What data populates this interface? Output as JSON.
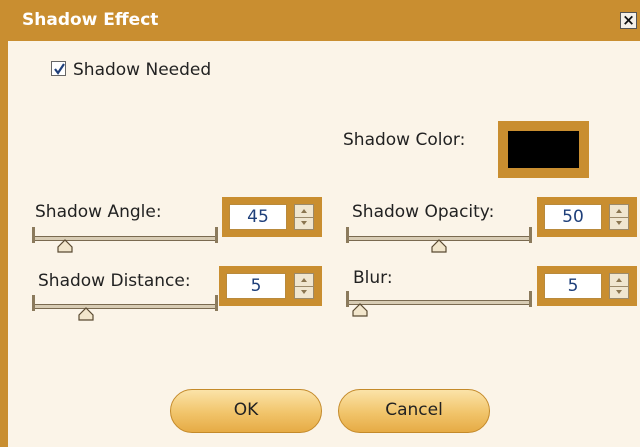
{
  "dialog": {
    "title": "Shadow Effect",
    "close_glyph": "×",
    "shadow_needed": {
      "label": "Shadow Needed",
      "checked": true
    },
    "shadow_color": {
      "label": "Shadow Color:",
      "value": "#000000"
    },
    "shadow_angle": {
      "label": "Shadow Angle:",
      "value": "45",
      "slider_fraction": 0.12
    },
    "shadow_opacity": {
      "label": "Shadow Opacity:",
      "value": "50",
      "slider_fraction": 0.5
    },
    "shadow_distance": {
      "label": "Shadow Distance:",
      "value": "5",
      "slider_fraction": 0.25
    },
    "blur": {
      "label": "Blur:",
      "value": "5",
      "slider_fraction": 0.0
    },
    "ok_label": "OK",
    "cancel_label": "Cancel"
  },
  "colors": {
    "accent": "#c98e30",
    "background": "#fbf4e8",
    "button": "#f1c46a"
  },
  "icons": {
    "close": "close-icon",
    "check": "checkmark-icon",
    "spin_up": "spin-up-icon",
    "spin_down": "spin-down-icon",
    "thumb": "slider-thumb-icon"
  }
}
